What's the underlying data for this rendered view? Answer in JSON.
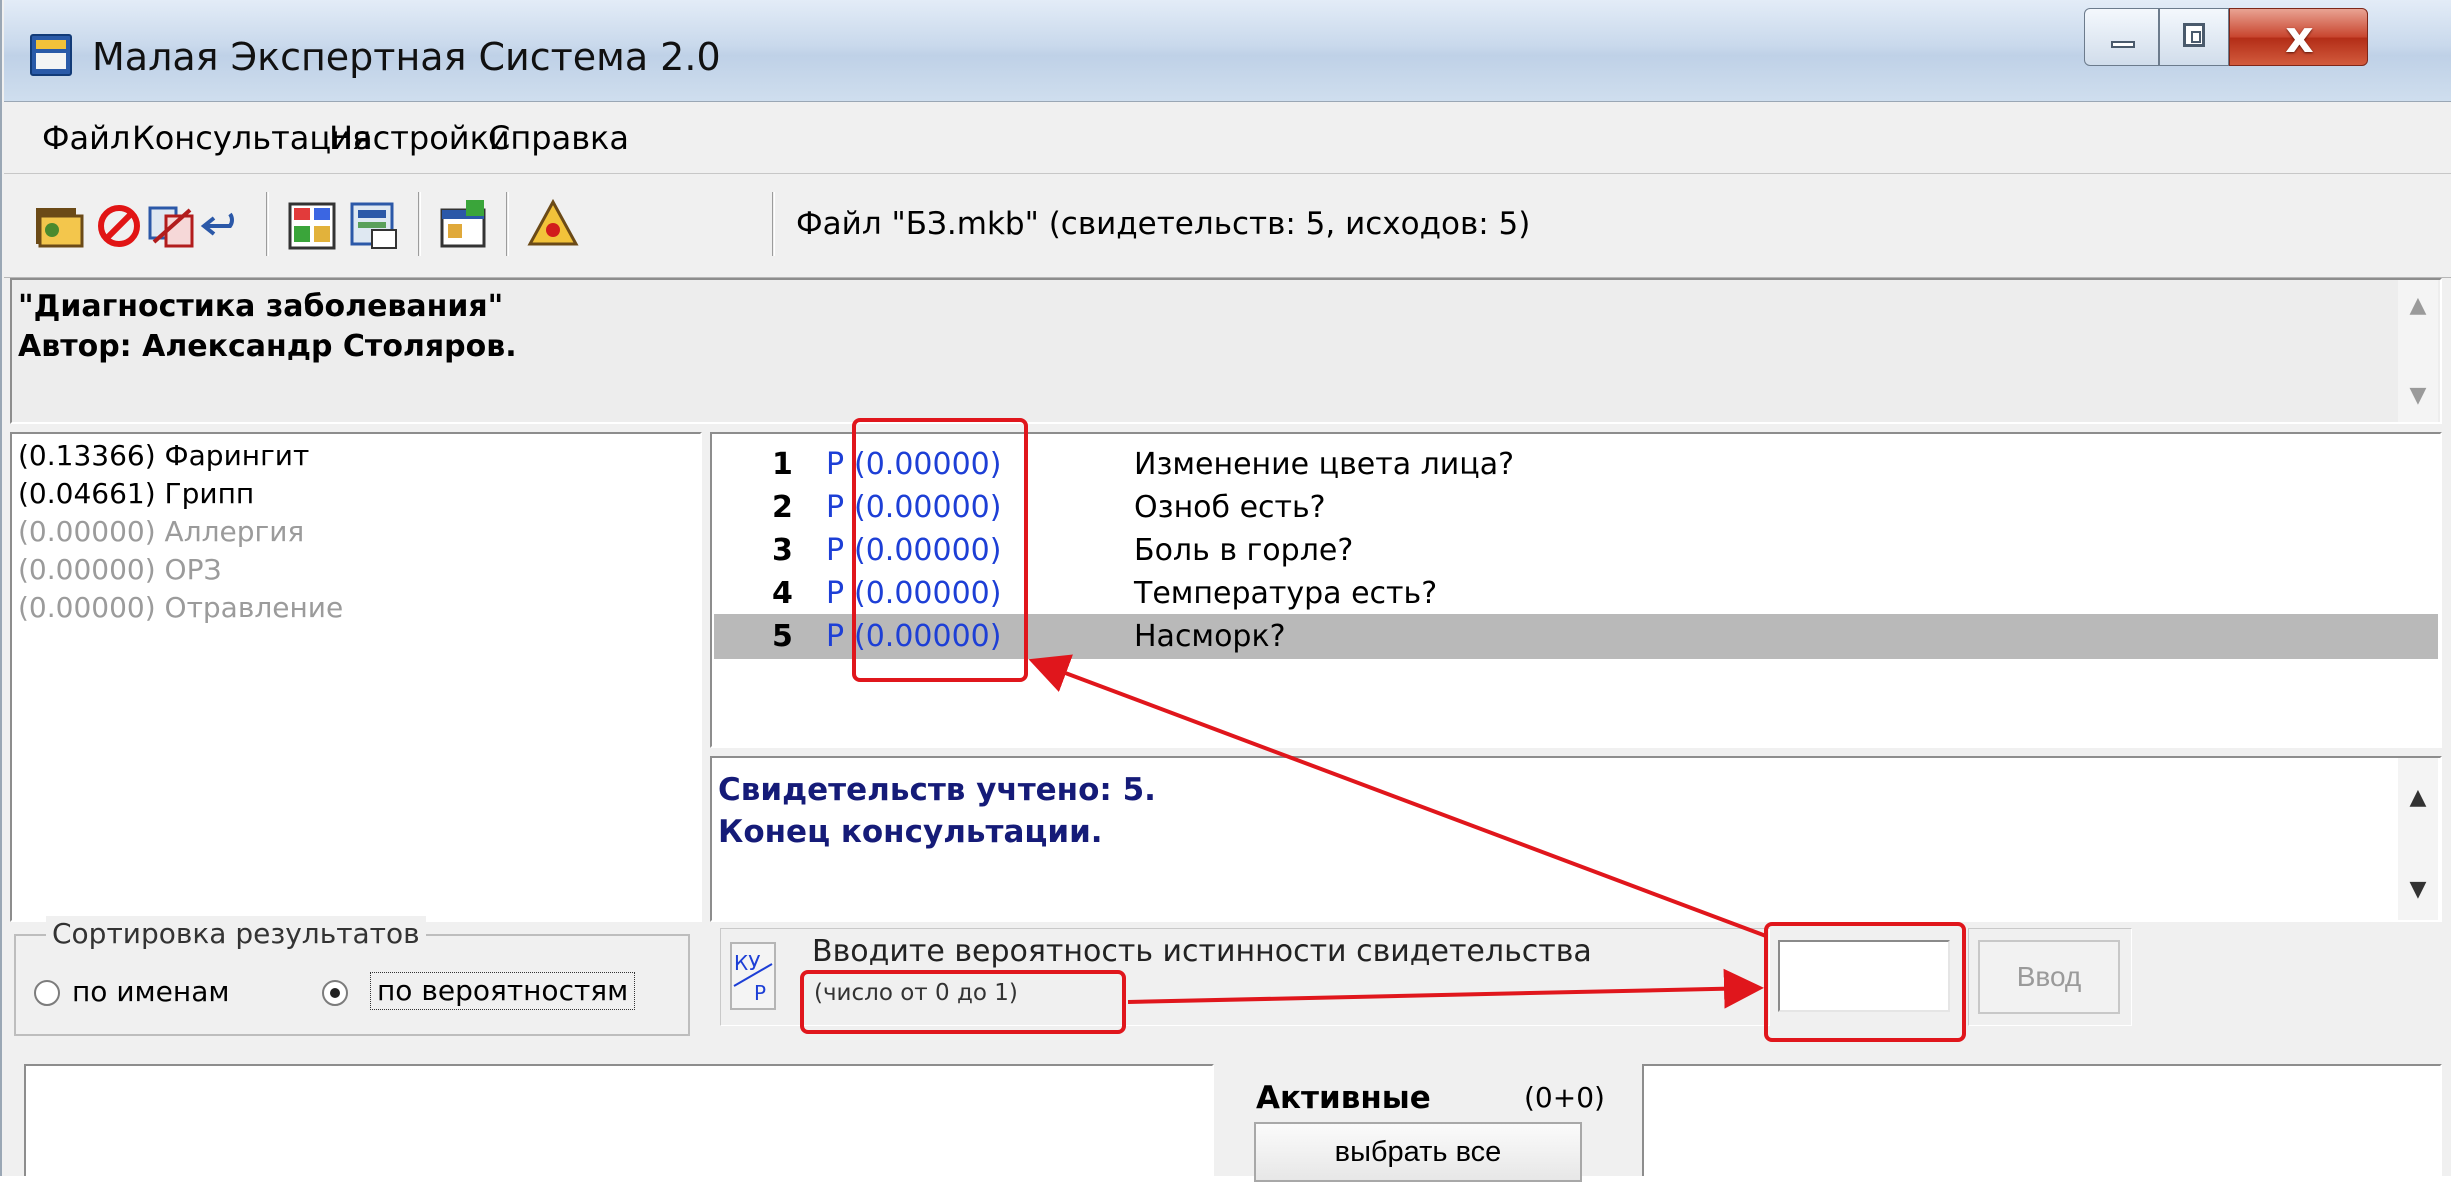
{
  "window": {
    "title": "Малая Экспертная Система 2.0",
    "close_glyph": "x"
  },
  "menu": [
    "Файл",
    "Консультация",
    "Настройки",
    "Справка"
  ],
  "toolbar": {
    "icons": [
      "open-icon",
      "stop-icon",
      "reset-icon",
      "undo-icon",
      "evidence-icon",
      "outcomes-icon",
      "properties-icon",
      "warning-icon"
    ],
    "status": "Файл \"БЗ.mkb\" (свидетельств: 5, исходов: 5)"
  },
  "info": {
    "title": "\"Диагностика заболевания\"",
    "author": "Автор: Александр Столяров."
  },
  "results": [
    {
      "value": "(0.13366)",
      "name": "Фарингит",
      "active": true
    },
    {
      "value": "(0.04661)",
      "name": "Грипп",
      "active": true
    },
    {
      "value": "(0.00000)",
      "name": "Аллергия",
      "active": false
    },
    {
      "value": "(0.00000)",
      "name": "ОРЗ",
      "active": false
    },
    {
      "value": "(0.00000)",
      "name": "Отравление",
      "active": false
    }
  ],
  "questions": [
    {
      "num": "1",
      "flag": "P",
      "value": "(0.00000)",
      "text": "Изменение цвета лица?",
      "selected": false
    },
    {
      "num": "2",
      "flag": "P",
      "value": "(0.00000)",
      "text": "Озноб есть?",
      "selected": false
    },
    {
      "num": "3",
      "flag": "P",
      "value": "(0.00000)",
      "text": "Боль в горле?",
      "selected": false
    },
    {
      "num": "4",
      "flag": "P",
      "value": "(0.00000)",
      "text": "Температура есть?",
      "selected": false
    },
    {
      "num": "5",
      "flag": "P",
      "value": "(0.00000)",
      "text": "Насморк?",
      "selected": true
    }
  ],
  "log": {
    "line1": "Свидетельств учтено: 5.",
    "line2": "Конец консультации."
  },
  "sort": {
    "legend": "Сортировка результатов",
    "by_name": "по именам",
    "by_probability": "по вероятностям",
    "selected": "by_probability"
  },
  "input": {
    "help_label_top": "КУ",
    "help_label_bottom": "P",
    "prompt": "Вводите вероятность истинности свидетельства",
    "hint": "(число от 0 до 1)",
    "value": "",
    "enter_label": "Ввод"
  },
  "active": {
    "title": "Активные",
    "count": "(0+0)",
    "select_all": "выбрать все"
  },
  "colors": {
    "annotation": "#e0161c",
    "probability_text": "#1d3fd6",
    "log_text": "#151b78",
    "selected_row": "#b9b9b9"
  }
}
